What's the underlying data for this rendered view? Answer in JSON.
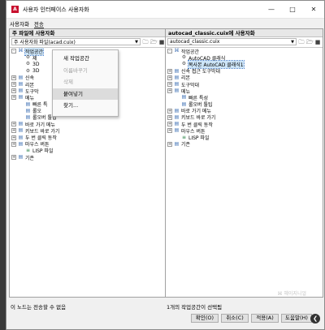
{
  "window": {
    "app_icon": "A",
    "title": "사용자 인터페이스 사용자화",
    "minimize": "—",
    "maximize": "□",
    "close": "✕"
  },
  "menubar": {
    "tabs": [
      "사용자화",
      "전송"
    ]
  },
  "left_pane": {
    "header": "주 파일에 사용자화",
    "dropdown": "주 사용자화 파일(acad.cuix)",
    "tree": [
      {
        "label": "작업공간",
        "icon": "workspace-icon",
        "exp": "-",
        "indent": 0,
        "selected": true
      },
      {
        "label": "제",
        "icon": "gear-icon",
        "indent": 1
      },
      {
        "label": "3D",
        "icon": "gear-icon",
        "indent": 1
      },
      {
        "label": "3D",
        "icon": "gear-icon",
        "indent": 1
      },
      {
        "label": "신속",
        "icon": "folder-icon",
        "exp": "+",
        "indent": 0
      },
      {
        "label": "리본",
        "icon": "folder-icon",
        "exp": "+",
        "indent": 0
      },
      {
        "label": "도구막",
        "icon": "folder-icon",
        "exp": "+",
        "indent": 0
      },
      {
        "label": "메뉴",
        "icon": "folder-icon",
        "exp": "+",
        "indent": 0
      },
      {
        "label": "빠른 특",
        "icon": "folder-icon",
        "indent": 1
      },
      {
        "label": "롤오",
        "icon": "folder-icon",
        "indent": 1
      },
      {
        "label": "롤오버 툴팁",
        "icon": "folder-icon",
        "indent": 1
      },
      {
        "label": "바로 가기 메뉴",
        "icon": "folder-icon",
        "exp": "+",
        "indent": 0
      },
      {
        "label": "키보드 바로 가기",
        "icon": "folder-icon",
        "exp": "+",
        "indent": 0
      },
      {
        "label": "두 번 클릭 동작",
        "icon": "folder-icon",
        "exp": "+",
        "indent": 0
      },
      {
        "label": "마우스 버튼",
        "icon": "folder-icon",
        "exp": "+",
        "indent": 0
      },
      {
        "label": "LISP 파일",
        "icon": "lisp-icon",
        "indent": 1
      },
      {
        "label": "기존",
        "icon": "folder-icon",
        "exp": "+",
        "indent": 0
      }
    ],
    "status": "이 노드는 전송할 수 없음"
  },
  "right_pane": {
    "header": "autocad_classic.cuix에 사용자화",
    "dropdown": "autocad_classic.cuix",
    "tree": [
      {
        "label": "작업공간",
        "icon": "workspace-icon",
        "exp": "-",
        "indent": 0
      },
      {
        "label": "AutoCAD 클래식",
        "icon": "gear-icon",
        "indent": 1
      },
      {
        "label": "복사본 AutoCAD 클래식1",
        "icon": "gear-icon",
        "indent": 1,
        "selected": true
      },
      {
        "label": "신속 접근 도구막대",
        "icon": "folder-icon",
        "exp": "+",
        "indent": 0
      },
      {
        "label": "리본",
        "icon": "folder-icon",
        "exp": "+",
        "indent": 0
      },
      {
        "label": "도구막대",
        "icon": "folder-icon",
        "exp": "+",
        "indent": 0
      },
      {
        "label": "메뉴",
        "icon": "folder-icon",
        "exp": "+",
        "indent": 0
      },
      {
        "label": "빠른 특성",
        "icon": "folder-icon",
        "indent": 1
      },
      {
        "label": "롤오버 툴팁",
        "icon": "folder-icon",
        "indent": 1
      },
      {
        "label": "바로 가기 메뉴",
        "icon": "folder-icon",
        "exp": "+",
        "indent": 0
      },
      {
        "label": "키보드 바로 가기",
        "icon": "folder-icon",
        "exp": "+",
        "indent": 0
      },
      {
        "label": "두 번 클릭 동작",
        "icon": "folder-icon",
        "exp": "+",
        "indent": 0
      },
      {
        "label": "마우스 버튼",
        "icon": "folder-icon",
        "exp": "+",
        "indent": 0
      },
      {
        "label": "LISP 파일",
        "icon": "lisp-icon",
        "indent": 1
      },
      {
        "label": "기존",
        "icon": "folder-icon",
        "exp": "+",
        "indent": 0
      }
    ],
    "status": "1개의 작업공간이 선택됨"
  },
  "context_menu": {
    "items": [
      {
        "label": "새 작업공간",
        "disabled": false
      },
      {
        "label": "이름바꾸기",
        "disabled": true
      },
      {
        "label": "삭제",
        "disabled": true
      },
      {
        "label": "붙여넣기",
        "disabled": false,
        "hover": true
      },
      {
        "label": "찾기...",
        "disabled": false
      }
    ]
  },
  "buttons": {
    "ok": "확인(O)",
    "cancel": "취소(C)",
    "apply": "적용(A)",
    "help": "도움말(H)"
  },
  "watermark": "⌘ 헤이지니얼"
}
